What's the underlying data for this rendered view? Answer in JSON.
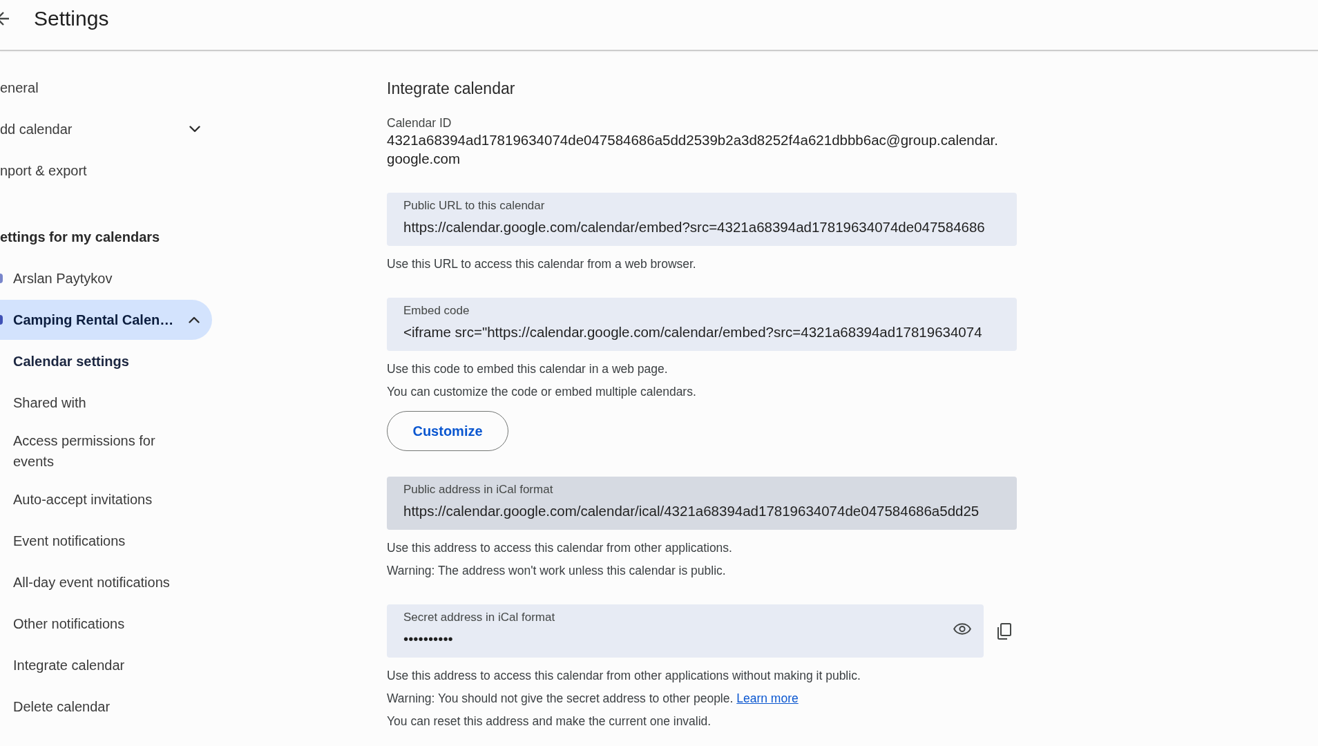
{
  "header": {
    "title": "Settings"
  },
  "sidebar": {
    "items": [
      {
        "kind": "link",
        "label": "eneral",
        "selected": false
      },
      {
        "kind": "dropdown",
        "label": "dd calendar",
        "expanded": false
      },
      {
        "kind": "link",
        "label": "nport & export",
        "selected": false
      }
    ],
    "section_title": "ettings for my calendars",
    "calendars": [
      {
        "label": "Arslan Paytykov",
        "color": "#7986cb",
        "selected": false,
        "expanded": false
      },
      {
        "label": "Camping Rental Calen…",
        "color": "#3f51b5",
        "selected": true,
        "expanded": true,
        "children": [
          {
            "label": "Calendar settings",
            "selected": true
          },
          {
            "label": "Shared with",
            "selected": false
          },
          {
            "label": "Access permissions for events",
            "selected": false
          },
          {
            "label": "Auto-accept invitations",
            "selected": false
          },
          {
            "label": "Event notifications",
            "selected": false
          },
          {
            "label": "All-day event notifications",
            "selected": false
          },
          {
            "label": "Other notifications",
            "selected": false
          },
          {
            "label": "Integrate calendar",
            "selected": false
          },
          {
            "label": "Delete calendar",
            "selected": false
          }
        ]
      }
    ]
  },
  "main": {
    "title": "Integrate calendar",
    "calendar_id": {
      "label": "Calendar ID",
      "value": "4321a68394ad17819634074de047584686a5dd2539b2a3d8252f4a621dbbb6ac@group.calendar.google.com"
    },
    "fields": [
      {
        "kind": "text",
        "label": "Public URL to this calendar",
        "value": "https://calendar.google.com/calendar/embed?src=4321a68394ad17819634074de047584686",
        "hovered": false,
        "notes": [
          {
            "text": "Use this URL to access this calendar from a web browser."
          }
        ]
      },
      {
        "kind": "text",
        "label": "Embed code",
        "value": "<iframe src=\"https://calendar.google.com/calendar/embed?src=4321a68394ad17819634074",
        "hovered": false,
        "notes": [
          {
            "text": "Use this code to embed this calendar in a web page."
          },
          {
            "text": "You can customize the code or embed multiple calendars."
          }
        ],
        "button": "Customize"
      },
      {
        "kind": "text",
        "label": "Public address in iCal format",
        "value": "https://calendar.google.com/calendar/ical/4321a68394ad17819634074de047584686a5dd25",
        "hovered": true,
        "notes": [
          {
            "text": "Use this address to access this calendar from other applications."
          },
          {
            "text": "Warning: The address won't work unless this calendar is public."
          }
        ]
      },
      {
        "kind": "secret",
        "label": "Secret address in iCal format",
        "value": "••••••••••",
        "hovered": false,
        "notes": [
          {
            "text": "Use this address to access this calendar from other applications without making it public."
          },
          {
            "text": "Warning: You should not give the secret address to other people.",
            "link": "Learn more"
          },
          {
            "text": "You can reset this address and make the current one invalid."
          }
        ]
      }
    ]
  }
}
